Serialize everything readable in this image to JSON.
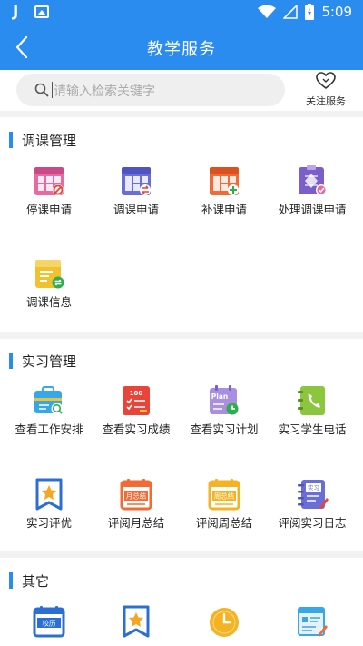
{
  "status_bar": {
    "app_glyph": "J",
    "time": "5:09"
  },
  "header": {
    "title": "教学服务"
  },
  "search": {
    "placeholder": "请输入检索关键字"
  },
  "follow": {
    "label": "关注服务"
  },
  "colors": {
    "primary": "#2b8cf0",
    "background": "#f2f2f2"
  },
  "sections": [
    {
      "title": "调课管理",
      "items": [
        {
          "label": "停课申请",
          "icon": "calendar-stop-icon"
        },
        {
          "label": "调课申请",
          "icon": "calendar-swap-icon"
        },
        {
          "label": "补课申请",
          "icon": "calendar-add-icon"
        },
        {
          "label": "处理调课申请",
          "icon": "handle-request-icon"
        },
        {
          "label": "调课信息",
          "icon": "info-swap-icon"
        }
      ]
    },
    {
      "title": "实习管理",
      "items": [
        {
          "label": "查看工作安排",
          "icon": "work-schedule-icon"
        },
        {
          "label": "查看实习成绩",
          "icon": "score-icon",
          "badge": "100"
        },
        {
          "label": "查看实习计划",
          "icon": "plan-icon",
          "badge": "Plan"
        },
        {
          "label": "实习学生电话",
          "icon": "phone-book-icon"
        },
        {
          "label": "实习评优",
          "icon": "award-icon"
        },
        {
          "label": "评阅月总结",
          "icon": "monthly-summary-icon",
          "badge": "月总结"
        },
        {
          "label": "评阅周总结",
          "icon": "weekly-summary-icon",
          "badge": "周总结"
        },
        {
          "label": "评阅实习日志",
          "icon": "internship-log-icon",
          "badge": "实习"
        }
      ]
    },
    {
      "title": "其它",
      "items": [
        {
          "label": "",
          "icon": "school-calendar-icon",
          "badge": "校历"
        },
        {
          "label": "",
          "icon": "favorite-icon"
        },
        {
          "label": "",
          "icon": "clock-icon"
        },
        {
          "label": "",
          "icon": "edit-document-icon"
        }
      ]
    }
  ]
}
